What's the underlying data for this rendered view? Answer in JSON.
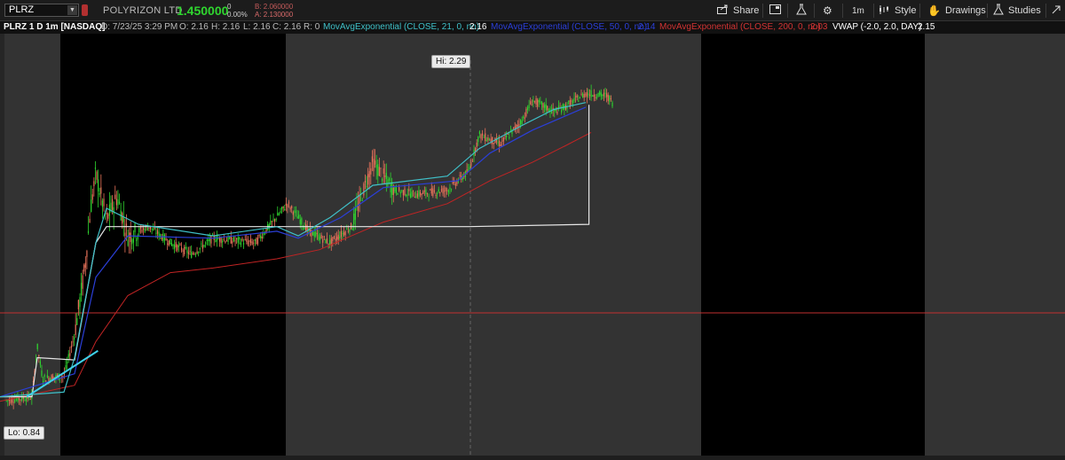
{
  "header": {
    "symbol": "PLRZ",
    "company": "POLYRIZON LTD",
    "last_price": "1.450000",
    "net_change": "0",
    "pct_change": "0.00%",
    "bid": "B: 2.060000",
    "ask": "A: 2.130000",
    "toolbar": {
      "share": "Share",
      "timeframe": "1m",
      "style": "Style",
      "drawings": "Drawings",
      "studies": "Studies"
    }
  },
  "infobar": {
    "chart_title": "PLRZ 1 D 1m [NASDAQ]",
    "date": "D: 7/23/25 3:29 PM",
    "open": "O: 2.16",
    "high": "H: 2.16",
    "low": "L: 2.16",
    "close": "C: 2.16",
    "range": "R: 0",
    "ema21_label": "MovAvgExponential (CLOSE, 21, 0, no)",
    "ema21_value": "2.16",
    "ema50_label": "MovAvgExponential (CLOSE, 50, 0, no)",
    "ema50_value": "2.14",
    "ema200_label": "MovAvgExponential (CLOSE, 200, 0, no)",
    "ema200_value": "2.03",
    "vwap_label": "VWAP (-2.0, 2.0, DAY)",
    "vwap_value": "2.15"
  },
  "chart_annotations": {
    "high_label": "Hi: 2.29",
    "low_label": "Lo: 0.84"
  },
  "colors": {
    "ema21": "#3fc0c8",
    "ema50": "#2b3fd8",
    "ema200": "#c22424",
    "vwap": "#e6e6e6",
    "up_candle": "#2fd52f",
    "down_candle": "#e8725a",
    "extended_hours_bg": "#333333",
    "regular_hours_bg": "#000000"
  },
  "chart_data": {
    "type": "candlestick",
    "symbol": "PLRZ",
    "interval": "1m",
    "ylim": [
      0.84,
      2.29
    ],
    "sessions": [
      "pre-market",
      "regular",
      "after-hours",
      "pre-market",
      "regular",
      "after-hours"
    ],
    "ema21_path": [
      [
        0.0,
        0.88
      ],
      [
        0.06,
        0.9
      ],
      [
        0.07,
        1.05
      ],
      [
        0.09,
        1.55
      ],
      [
        0.1,
        1.7
      ],
      [
        0.13,
        1.63
      ],
      [
        0.2,
        1.58
      ],
      [
        0.26,
        1.62
      ],
      [
        0.28,
        1.58
      ],
      [
        0.31,
        1.66
      ],
      [
        0.35,
        1.8
      ],
      [
        0.42,
        1.84
      ],
      [
        0.45,
        1.96
      ],
      [
        0.49,
        2.06
      ],
      [
        0.52,
        2.13
      ],
      [
        0.55,
        2.16
      ]
    ],
    "ema50_path": [
      [
        0.0,
        0.88
      ],
      [
        0.07,
        0.98
      ],
      [
        0.09,
        1.4
      ],
      [
        0.12,
        1.58
      ],
      [
        0.2,
        1.57
      ],
      [
        0.26,
        1.6
      ],
      [
        0.28,
        1.57
      ],
      [
        0.32,
        1.66
      ],
      [
        0.36,
        1.79
      ],
      [
        0.43,
        1.82
      ],
      [
        0.46,
        1.94
      ],
      [
        0.5,
        2.04
      ],
      [
        0.53,
        2.1
      ],
      [
        0.55,
        2.14
      ]
    ],
    "ema200_path": [
      [
        0.0,
        0.86
      ],
      [
        0.07,
        0.93
      ],
      [
        0.09,
        1.12
      ],
      [
        0.12,
        1.32
      ],
      [
        0.16,
        1.42
      ],
      [
        0.2,
        1.44
      ],
      [
        0.26,
        1.48
      ],
      [
        0.3,
        1.52
      ],
      [
        0.33,
        1.58
      ],
      [
        0.36,
        1.64
      ],
      [
        0.42,
        1.72
      ],
      [
        0.46,
        1.82
      ],
      [
        0.5,
        1.9
      ],
      [
        0.53,
        1.97
      ],
      [
        0.555,
        2.03
      ]
    ],
    "vwap_path": [
      [
        0.0,
        0.88
      ],
      [
        0.03,
        0.88
      ],
      [
        0.035,
        1.05
      ],
      [
        0.07,
        1.04
      ],
      [
        0.09,
        1.55
      ],
      [
        0.1,
        1.62
      ],
      [
        0.14,
        1.62
      ],
      [
        0.44,
        1.62
      ],
      [
        0.553,
        1.63
      ],
      [
        0.553,
        2.15
      ]
    ],
    "price_path": [
      [
        0.0,
        0.86
      ],
      [
        0.03,
        0.88
      ],
      [
        0.035,
        1.1
      ],
      [
        0.04,
        0.96
      ],
      [
        0.06,
        0.97
      ],
      [
        0.07,
        1.15
      ],
      [
        0.08,
        1.45
      ],
      [
        0.085,
        1.7
      ],
      [
        0.09,
        1.85
      ],
      [
        0.1,
        1.65
      ],
      [
        0.11,
        1.75
      ],
      [
        0.12,
        1.58
      ],
      [
        0.14,
        1.62
      ],
      [
        0.16,
        1.55
      ],
      [
        0.18,
        1.5
      ],
      [
        0.2,
        1.57
      ],
      [
        0.24,
        1.55
      ],
      [
        0.27,
        1.72
      ],
      [
        0.29,
        1.6
      ],
      [
        0.31,
        1.55
      ],
      [
        0.33,
        1.62
      ],
      [
        0.35,
        1.9
      ],
      [
        0.37,
        1.78
      ],
      [
        0.39,
        1.76
      ],
      [
        0.42,
        1.78
      ],
      [
        0.44,
        1.86
      ],
      [
        0.45,
        2.02
      ],
      [
        0.47,
        1.98
      ],
      [
        0.49,
        2.08
      ],
      [
        0.5,
        2.17
      ],
      [
        0.52,
        2.12
      ],
      [
        0.53,
        2.14
      ],
      [
        0.55,
        2.2
      ],
      [
        0.57,
        2.19
      ],
      [
        0.575,
        2.16
      ]
    ]
  }
}
